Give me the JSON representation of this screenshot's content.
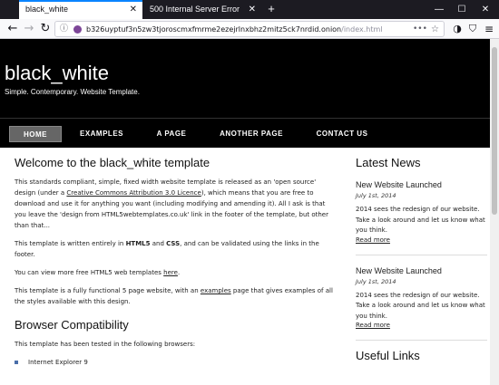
{
  "browser": {
    "tabs": [
      {
        "title": "black_white",
        "active": true
      },
      {
        "title": "500 Internal Server Error",
        "active": false
      }
    ],
    "url": {
      "host": "b326uyptuf3n5zw3tjoroscmxfmrme2ezejrlnxbhz2mitz5ck7nrdid.onion",
      "path": "/index.html"
    },
    "icons": {
      "back": "back-arrow-icon",
      "forward": "forward-arrow-icon",
      "reload": "reload-icon",
      "info": "info-icon",
      "onion": "onion-icon",
      "more": "page-actions-icon",
      "bookmark": "star-icon",
      "tor_circuit": "tor-circuit-icon",
      "shield": "shield-icon",
      "menu": "hamburger-menu-icon",
      "close": "close-icon",
      "new_tab": "plus-icon",
      "minimize": "minimize-icon",
      "maximize": "maximize-icon"
    }
  },
  "header": {
    "title": "black_white",
    "slogan": "Simple. Contemporary. Website Template."
  },
  "menu": {
    "items": [
      {
        "label": "HOME",
        "selected": true
      },
      {
        "label": "EXAMPLES",
        "selected": false
      },
      {
        "label": "A PAGE",
        "selected": false
      },
      {
        "label": "ANOTHER PAGE",
        "selected": false
      },
      {
        "label": "CONTACT US",
        "selected": false
      }
    ]
  },
  "main": {
    "heading": "Welcome to the black_white template",
    "p1_a": "This standards compliant, simple, fixed width website template is released as an 'open source' design (under a ",
    "p1_link": "Creative Commons Attribution 3.0 Licence",
    "p1_b": "), which means that you are free to download and use it for anything you want (including modifying and amending it). All I ask is that you leave the 'design from HTML5webtemplates.co.uk' link in the footer of the template, but other than that...",
    "p2_a": "This template is written entirely in ",
    "p2_html": "HTML5",
    "p2_mid": " and ",
    "p2_css": "CSS",
    "p2_b": ", and can be validated using the links in the footer.",
    "p3_a": "You can view more free HTML5 web templates ",
    "p3_link": "here",
    "p3_b": ".",
    "p4_a": "This template is a fully functional 5 page website, with an ",
    "p4_link": "examples",
    "p4_b": " page that gives examples of all the styles available with this design.",
    "compat_heading": "Browser Compatibility",
    "compat_intro": "This template has been tested in the following browsers:",
    "browsers": [
      "Internet Explorer 9"
    ]
  },
  "sidebar": {
    "news_heading": "Latest News",
    "news": [
      {
        "title": "New Website Launched",
        "date": "July 1st, 2014",
        "body": "2014 sees the redesign of our website. Take a look around and let us know what you think.",
        "link": "Read more"
      },
      {
        "title": "New Website Launched",
        "date": "July 1st, 2014",
        "body": "2014 sees the redesign of our website. Take a look around and let us know what you think.",
        "link": "Read more"
      }
    ],
    "links_heading": "Useful Links"
  },
  "colors": {
    "header_bg": "#000000",
    "menu_selected_bg": "#666666",
    "bullet": "#4a6ea9",
    "tab_accent": "#0a84ff",
    "tabbar_bg": "#1c1b22"
  }
}
